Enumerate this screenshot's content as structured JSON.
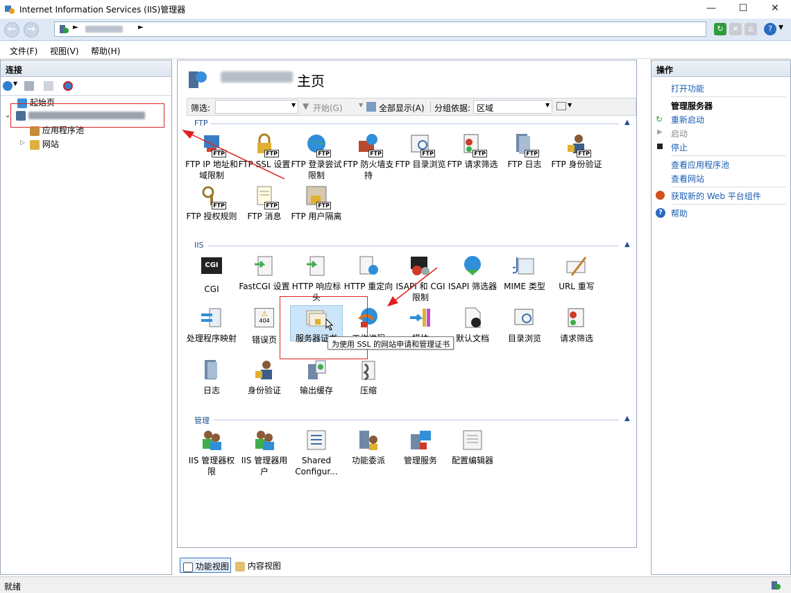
{
  "window": {
    "title": "Internet Information Services (IIS)管理器"
  },
  "menu": [
    "文件(F)",
    "视图(V)",
    "帮助(H)"
  ],
  "connections": {
    "header": "连接",
    "start_page": "起始页",
    "app_pools": "应用程序池",
    "sites": "网站"
  },
  "center": {
    "title_suffix": "主页",
    "filter_label": "筛选:",
    "start_label": "开始(G)",
    "show_all_label": "全部显示(A)",
    "group_label": "分组依据:",
    "group_value": "区域",
    "sections": {
      "ftp": "FTP",
      "iis": "IIS",
      "manage": "管理"
    },
    "ftp_features": [
      "FTP IP 地址和域限制",
      "FTP SSL 设置",
      "FTP 登录尝试限制",
      "FTP 防火墙支持",
      "FTP 目录浏览",
      "FTP 请求筛选",
      "FTP 日志",
      "FTP 身份验证",
      "FTP 授权规则",
      "FTP 消息",
      "FTP 用户隔离"
    ],
    "iis_features": [
      "CGI",
      "FastCGI 设置",
      "HTTP 响应标头",
      "HTTP 重定向",
      "ISAPI 和 CGI 限制",
      "ISAPI 筛选器",
      "MIME 类型",
      "URL 重写",
      "处理程序映射",
      "错误页",
      "服务器证书",
      "工作进程",
      "模块",
      "默认文档",
      "目录浏览",
      "请求筛选",
      "日志",
      "身份验证",
      "输出缓存",
      "压缩"
    ],
    "manage_features": [
      "IIS 管理器权限",
      "IIS 管理器用户",
      "Shared Configur...",
      "功能委派",
      "管理服务",
      "配置编辑器"
    ],
    "tooltip": "为使用 SSL 的网站申请和管理证书",
    "cgi_icon_text": "CGI",
    "err_icon_text": "404",
    "ftp_tag": "FTP",
    "view_tabs": {
      "features": "功能视图",
      "content": "内容视图"
    }
  },
  "actions": {
    "header": "操作",
    "open_feature": "打开功能",
    "manage_server": "管理服务器",
    "restart": "重新启动",
    "start": "启动",
    "stop": "停止",
    "view_app_pools": "查看应用程序池",
    "view_sites": "查看网站",
    "get_components": "获取新的 Web 平台组件",
    "help": "帮助"
  },
  "status": {
    "text": "就绪"
  }
}
